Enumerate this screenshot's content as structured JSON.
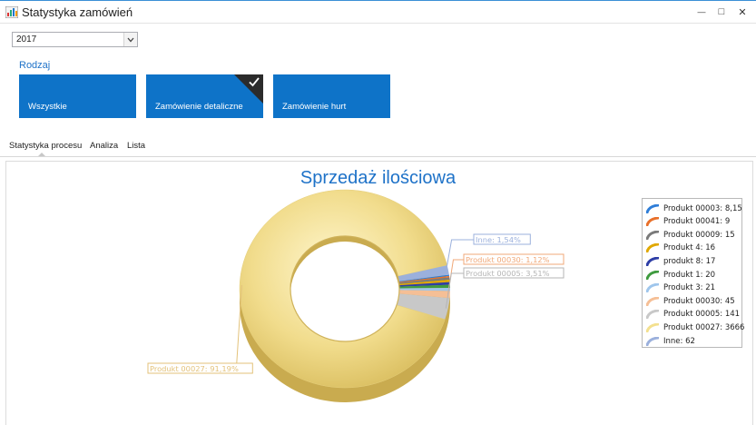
{
  "window": {
    "title": "Statystyka zamówień",
    "minimize_glyph": "—",
    "maximize_glyph": "□",
    "close_glyph": "✕"
  },
  "filter": {
    "year": "2017"
  },
  "group": {
    "label": "Rodzaj",
    "tiles": [
      {
        "label": "Wszystkie",
        "selected": false
      },
      {
        "label": "Zamówienie detaliczne",
        "selected": true
      },
      {
        "label": "Zamówienie hurt",
        "selected": false
      }
    ]
  },
  "tabs": [
    {
      "label": "Statystyka procesu",
      "active": true
    },
    {
      "label": "Analiza",
      "active": false
    },
    {
      "label": "Lista",
      "active": false
    }
  ],
  "chart_data": {
    "type": "pie",
    "donut": true,
    "title": "Sprzedaż ilościowa",
    "legend_position": "right",
    "series": [
      {
        "name": "Produkt 00003",
        "value": 8.15,
        "color": "#2f7ed8"
      },
      {
        "name": "Produkt 00041",
        "value": 9,
        "color": "#e8702a"
      },
      {
        "name": "Produkt 00009",
        "value": 15,
        "color": "#7a7a7a"
      },
      {
        "name": "Produkt 4",
        "value": 16,
        "color": "#e0a800"
      },
      {
        "name": "produkt 8",
        "value": 17,
        "color": "#2e3ea6"
      },
      {
        "name": "Produkt 1",
        "value": 20,
        "color": "#3f9b3f"
      },
      {
        "name": "Produkt 3",
        "value": 21,
        "color": "#9fc6ec"
      },
      {
        "name": "Produkt 00030",
        "value": 45,
        "color": "#f5bf96"
      },
      {
        "name": "Produkt 00005",
        "value": 141,
        "color": "#c8c8c8"
      },
      {
        "name": "Produkt 00027",
        "value": 3666,
        "color": "#f3e08f"
      },
      {
        "name": "Inne",
        "value": 62,
        "color": "#9bb0dc"
      }
    ],
    "legend_labels": [
      "Produkt 00003: 8,15",
      "Produkt 00041: 9",
      "Produkt 00009: 15",
      "Produkt 4: 16",
      "produkt 8: 17",
      "Produkt 1: 20",
      "Produkt 3: 21",
      "Produkt 00030: 45",
      "Produkt 00005: 141",
      "Produkt 00027: 3666",
      "Inne: 62"
    ],
    "slice_labels": [
      {
        "text": "Inne: 1,54%",
        "series": "Inne",
        "color": "#9bb0dc"
      },
      {
        "text": "Produkt 00030: 1,12%",
        "series": "Produkt 00030",
        "color": "#f0a878"
      },
      {
        "text": "Produkt 00005: 3,51%",
        "series": "Produkt 00005",
        "color": "#b5b5b5"
      },
      {
        "text": "Produkt 00027: 91,19%",
        "series": "Produkt 00027",
        "color": "#e3c27a"
      }
    ]
  }
}
